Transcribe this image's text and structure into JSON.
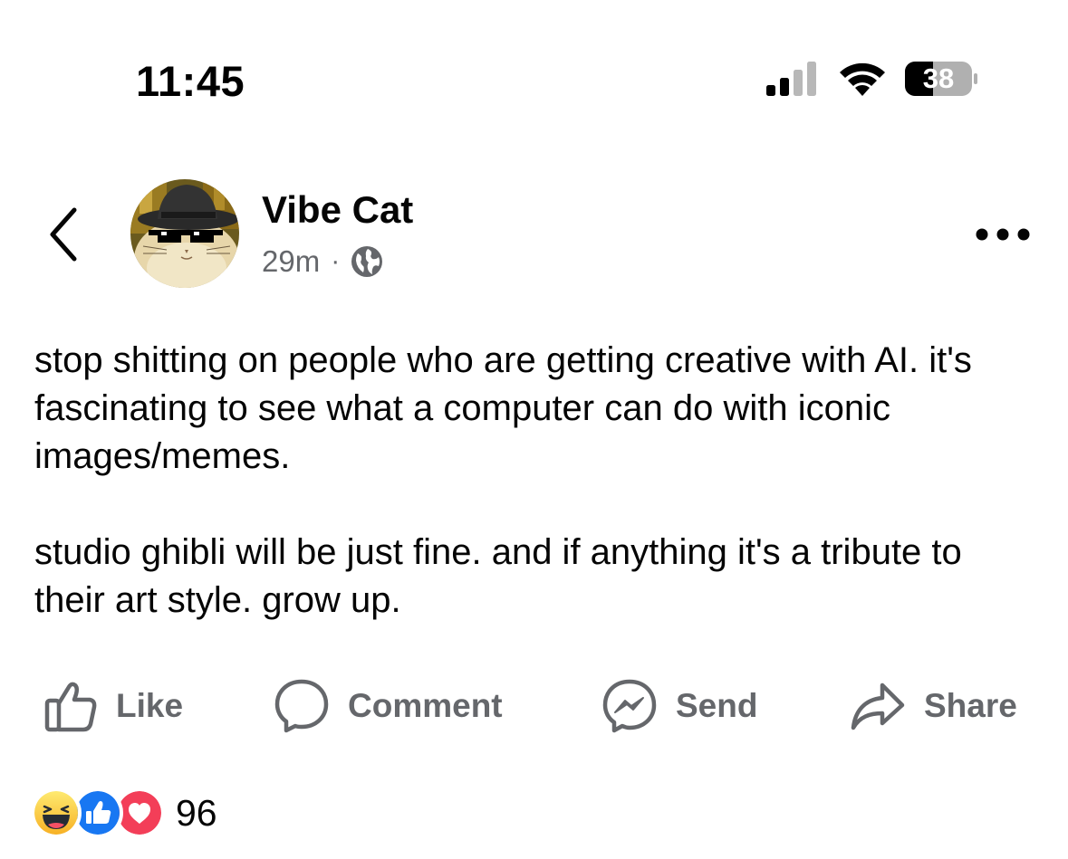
{
  "status_bar": {
    "time": "11:45",
    "battery_level": "38",
    "signal_bars_active": 2,
    "signal_bars_total": 4
  },
  "post": {
    "author": "Vibe Cat",
    "time_ago": "29m",
    "separator": "·",
    "audience_icon": "globe-icon",
    "body": [
      "stop shitting on people who are getting creative with AI. it's fascinating to see what a computer can do with iconic images/memes.",
      "studio ghibli will be just fine. and if anything it's a tribute to their art style. grow up."
    ]
  },
  "actions": {
    "like": "Like",
    "comment": "Comment",
    "send": "Send",
    "share": "Share"
  },
  "reactions": {
    "types": [
      "haha",
      "like",
      "love"
    ],
    "count": "96"
  },
  "colors": {
    "text_primary": "#050505",
    "text_secondary": "#65676b",
    "like_blue": "#1877f2",
    "love_red": "#f33e58",
    "haha_yellow": "#f7b125"
  }
}
